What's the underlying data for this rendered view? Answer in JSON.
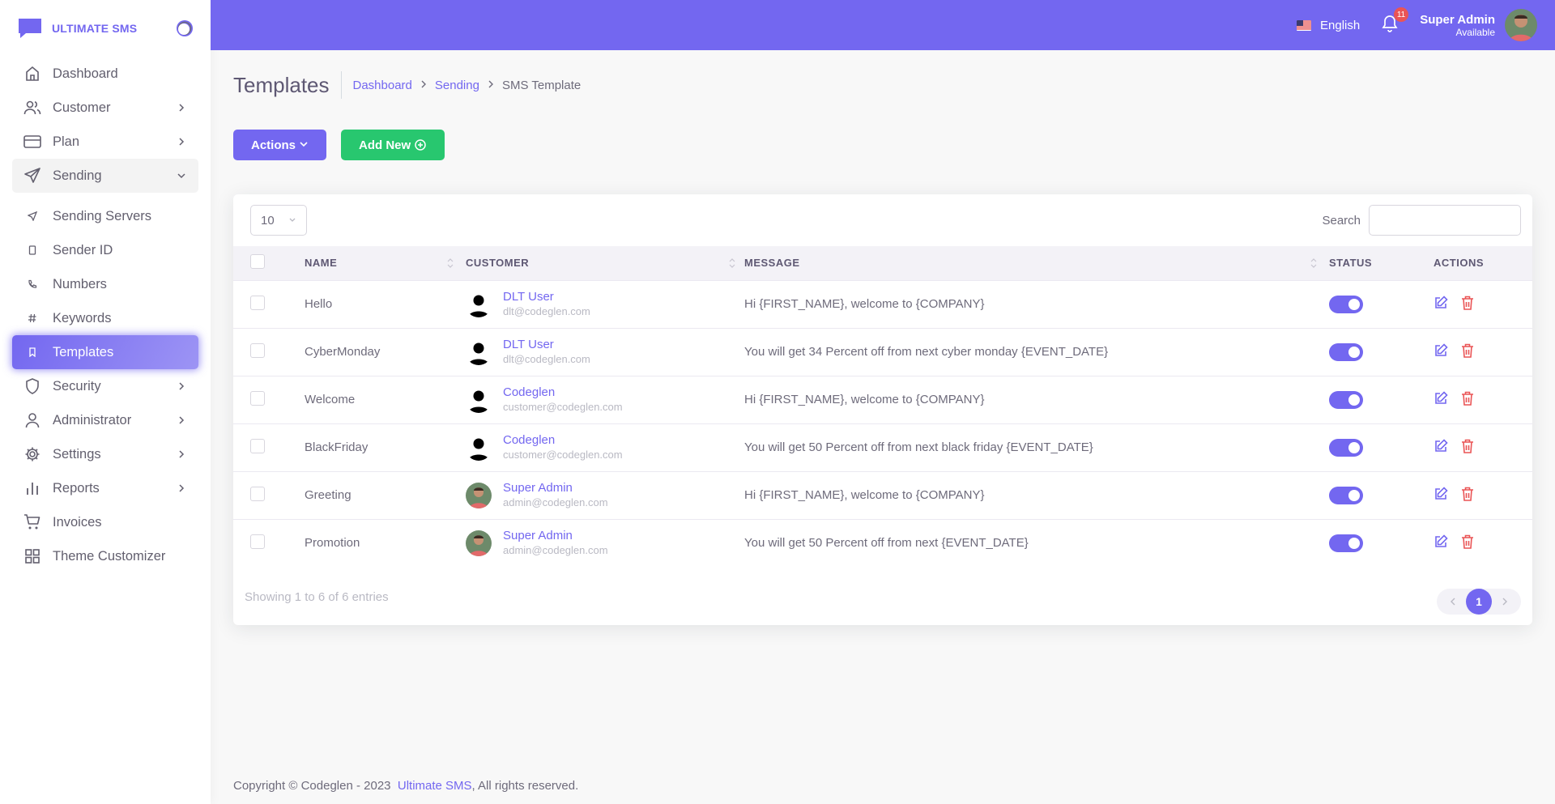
{
  "brand": {
    "name": "ULTIMATE SMS"
  },
  "sidebar": {
    "items": [
      {
        "label": "Dashboard"
      },
      {
        "label": "Customer"
      },
      {
        "label": "Plan"
      },
      {
        "label": "Sending"
      },
      {
        "label": "Sending Servers"
      },
      {
        "label": "Sender ID"
      },
      {
        "label": "Numbers"
      },
      {
        "label": "Keywords"
      },
      {
        "label": "Templates"
      },
      {
        "label": "Security"
      },
      {
        "label": "Administrator"
      },
      {
        "label": "Settings"
      },
      {
        "label": "Reports"
      },
      {
        "label": "Invoices"
      },
      {
        "label": "Theme Customizer"
      }
    ]
  },
  "header": {
    "language": "English",
    "notifications_count": "11",
    "user_name": "Super Admin",
    "user_status": "Available"
  },
  "page": {
    "title": "Templates",
    "breadcrumb": [
      "Dashboard",
      "Sending",
      "SMS Template"
    ],
    "actions_label": "Actions",
    "add_new_label": "Add New"
  },
  "table": {
    "page_length": "10",
    "search_label": "Search",
    "columns": [
      "NAME",
      "CUSTOMER",
      "MESSAGE",
      "STATUS",
      "ACTIONS"
    ],
    "rows": [
      {
        "name": "Hello",
        "customer": "DLT User",
        "email": "dlt@codeglen.com",
        "message": "Hi {FIRST_NAME}, welcome to {COMPANY}"
      },
      {
        "name": "CyberMonday",
        "customer": "DLT User",
        "email": "dlt@codeglen.com",
        "message": "You will get 34 Percent off from next cyber monday {EVENT_DATE}"
      },
      {
        "name": "Welcome",
        "customer": "Codeglen",
        "email": "customer@codeglen.com",
        "message": "Hi {FIRST_NAME}, welcome to {COMPANY}"
      },
      {
        "name": "BlackFriday",
        "customer": "Codeglen",
        "email": "customer@codeglen.com",
        "message": "You will get 50 Percent off from next black friday {EVENT_DATE}"
      },
      {
        "name": "Greeting",
        "customer": "Super Admin",
        "email": "admin@codeglen.com",
        "message": "Hi {FIRST_NAME}, welcome to {COMPANY}"
      },
      {
        "name": "Promotion",
        "customer": "Super Admin",
        "email": "admin@codeglen.com",
        "message": "You will get 50 Percent off from next {EVENT_DATE}"
      }
    ],
    "info": "Showing 1 to 6 of 6 entries",
    "current_page": "1"
  },
  "footer": {
    "copyright": "Copyright © Codeglen - 2023",
    "link": "Ultimate SMS",
    "suffix": ", All rights reserved."
  },
  "colors": {
    "primary": "#7367f0",
    "success": "#28c76f",
    "danger": "#ea5455"
  }
}
